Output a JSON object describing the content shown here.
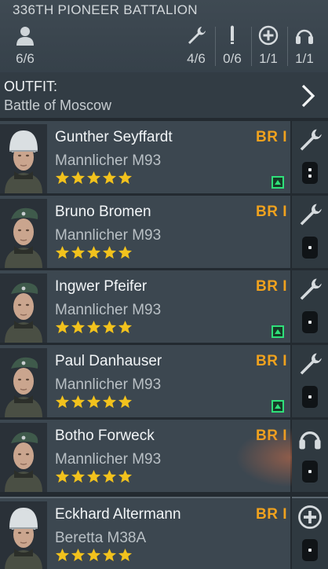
{
  "header": {
    "title": "336TH PIONEER BATTALION",
    "soldiers_count": "6/6",
    "slots": [
      {
        "icon": "wrench-icon",
        "value": "4/6"
      },
      {
        "icon": "ammo-icon",
        "value": "0/6"
      },
      {
        "icon": "medic-plus-icon",
        "value": "1/1"
      },
      {
        "icon": "headphones-icon",
        "value": "1/1"
      }
    ]
  },
  "outfit": {
    "label": "OUTFIT:",
    "value": "Battle of Moscow"
  },
  "soldiers": [
    {
      "name": "Gunther Seyffardt",
      "weapon": "Mannlicher M93",
      "br": "BR I",
      "stars": 5,
      "upgrade": true,
      "role_icon": "wrench-icon",
      "ammo_dots": 2,
      "helmet": "steel"
    },
    {
      "name": "Bruno Bromen",
      "weapon": "Mannlicher M93",
      "br": "BR I",
      "stars": 5,
      "upgrade": false,
      "role_icon": "wrench-icon",
      "ammo_dots": 1,
      "helmet": "cap"
    },
    {
      "name": "Ingwer Pfeifer",
      "weapon": "Mannlicher M93",
      "br": "BR I",
      "stars": 5,
      "upgrade": true,
      "role_icon": "wrench-icon",
      "ammo_dots": 1,
      "helmet": "cap"
    },
    {
      "name": "Paul Danhauser",
      "weapon": "Mannlicher M93",
      "br": "BR I",
      "stars": 5,
      "upgrade": true,
      "role_icon": "wrench-icon",
      "ammo_dots": 1,
      "helmet": "cap"
    },
    {
      "name": "Botho Forweck",
      "weapon": "Mannlicher M93",
      "br": "BR I",
      "stars": 5,
      "upgrade": false,
      "role_icon": "headphones-icon",
      "ammo_dots": 1,
      "helmet": "cap"
    },
    {
      "name": "Eckhard Altermann",
      "weapon": "Beretta M38A",
      "br": "BR I",
      "stars": 5,
      "upgrade": false,
      "role_icon": "medic-plus-icon",
      "ammo_dots": 1,
      "helmet": "steel"
    }
  ],
  "colors": {
    "background": "#232a30",
    "card": "#3c4750",
    "br_accent": "#f0a21e",
    "star": "#f2c21d",
    "upgrade": "#2fe07a"
  }
}
